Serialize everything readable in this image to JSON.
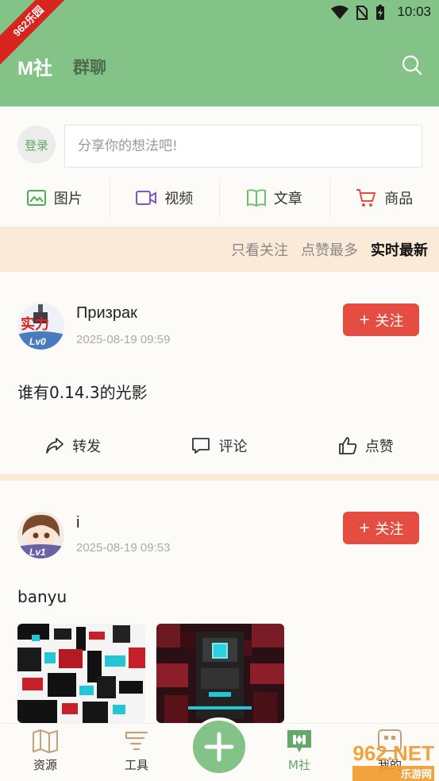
{
  "status": {
    "time": "10:03"
  },
  "ribbon": {
    "label": "962乐园"
  },
  "header": {
    "title": "M社",
    "tab": "群聊"
  },
  "composer": {
    "login_label": "登录",
    "placeholder": "分享你的想法吧!",
    "types": [
      {
        "label": "图片",
        "icon": "image-icon"
      },
      {
        "label": "视频",
        "icon": "video-icon"
      },
      {
        "label": "文章",
        "icon": "book-icon"
      },
      {
        "label": "商品",
        "icon": "cart-icon"
      }
    ]
  },
  "filters": [
    {
      "label": "只看关注",
      "active": false
    },
    {
      "label": "点赞最多",
      "active": false
    },
    {
      "label": "实时最新",
      "active": true
    }
  ],
  "posts": [
    {
      "username": "Призрак",
      "time": "2025-08-19 09:59",
      "level": "Lv0",
      "follow_label": "关注",
      "text": "谁有0.14.3的光影",
      "actions": {
        "share": "转发",
        "comment": "评论",
        "like": "点赞"
      }
    },
    {
      "username": "i",
      "time": "2025-08-19 09:53",
      "level": "Lv1",
      "follow_label": "关注",
      "text": "banyu"
    }
  ],
  "bottom_nav": [
    {
      "label": "资源",
      "icon": "map-icon"
    },
    {
      "label": "工具",
      "icon": "tools-icon"
    },
    {
      "label": "M社",
      "icon": "m-community-icon",
      "active": true
    },
    {
      "label": "我的",
      "icon": "profile-icon"
    }
  ],
  "watermark": {
    "text": "962.NET",
    "subtext": "乐游网"
  },
  "colors": {
    "header": "#84c388",
    "accent": "#62a866",
    "follow": "#e54d42",
    "filter_bg": "#fbead7"
  }
}
